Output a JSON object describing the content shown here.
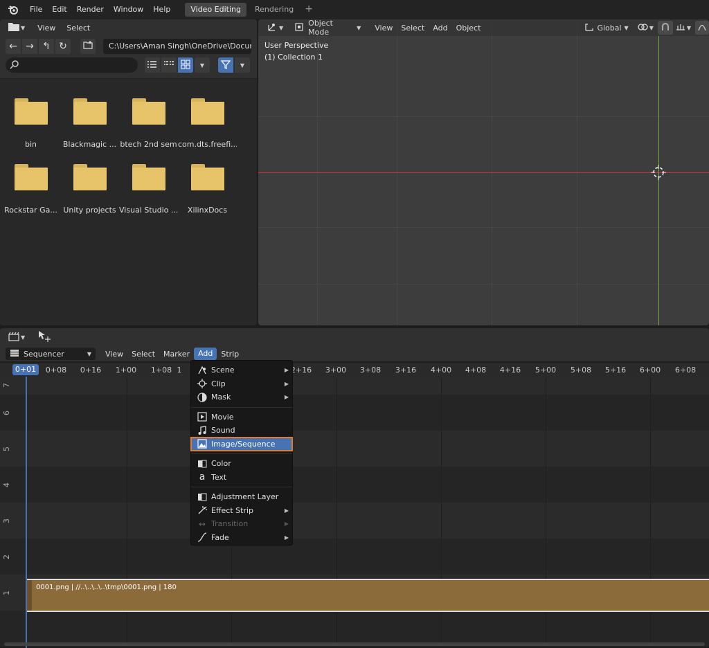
{
  "topbar": {
    "menu": [
      "File",
      "Edit",
      "Render",
      "Window",
      "Help"
    ],
    "workspaces": [
      {
        "label": "Video Editing",
        "active": true
      },
      {
        "label": "Rendering",
        "active": false
      }
    ],
    "add_tab": "+"
  },
  "file_browser": {
    "header": {
      "view": "View",
      "select": "Select"
    },
    "path": "C:\\Users\\Aman Singh\\OneDrive\\Documents\\",
    "search_placeholder": "",
    "folders": [
      "bin",
      "Blackmagic ...",
      "btech 2nd sem",
      "com.dts.freefi...",
      "Rockstar Ga...",
      "Unity projects",
      "Visual Studio ...",
      "XilinxDocs"
    ]
  },
  "viewport": {
    "mode": "Object Mode",
    "menu": [
      "View",
      "Select",
      "Add",
      "Object"
    ],
    "orientation": "Global",
    "perspective_label": "User Perspective",
    "collection_label": "(1) Collection 1"
  },
  "sequencer": {
    "editor_type": "Sequencer",
    "menu": [
      "View",
      "Select",
      "Marker",
      "Add",
      "Strip"
    ],
    "active_menu": "Add",
    "current_frame": "0+01",
    "ruler": [
      "0+08",
      "0+16",
      "1+00",
      "1+08",
      "1",
      "2+16",
      "3+00",
      "3+08",
      "3+16",
      "4+00",
      "4+08",
      "4+16",
      "5+00",
      "5+08",
      "5+16",
      "6+00",
      "6+08"
    ],
    "channels": [
      "7",
      "6",
      "5",
      "4",
      "3",
      "2",
      "1"
    ],
    "strip_label": "0001.png | //..\\..\\..\\..\\tmp\\0001.png | 180"
  },
  "add_menu": {
    "items": [
      {
        "label": "Scene",
        "icon": "scene-icon",
        "submenu": true
      },
      {
        "label": "Clip",
        "icon": "clip-icon",
        "submenu": true
      },
      {
        "label": "Mask",
        "icon": "mask-icon",
        "submenu": true
      },
      {
        "label": "Movie",
        "icon": "movie-icon",
        "submenu": false
      },
      {
        "label": "Sound",
        "icon": "sound-icon",
        "submenu": false
      },
      {
        "label": "Image/Sequence",
        "icon": "image-icon",
        "submenu": false,
        "highlighted": true
      },
      {
        "label": "Color",
        "icon": "color-icon",
        "submenu": false
      },
      {
        "label": "Text",
        "icon": "text-icon",
        "submenu": false
      },
      {
        "label": "Adjustment Layer",
        "icon": "adjustment-icon",
        "submenu": false
      },
      {
        "label": "Effect Strip",
        "icon": "effect-icon",
        "submenu": true
      },
      {
        "label": "Transition",
        "icon": "transition-icon",
        "submenu": true,
        "disabled": true
      },
      {
        "label": "Fade",
        "icon": "fade-icon",
        "submenu": true
      }
    ]
  },
  "colors": {
    "accent": "#4772b3",
    "strip": "#8c6b3b",
    "highlight_box": "#e07b2e",
    "x_axis": "#c0393b",
    "y_axis": "#7aa33a"
  }
}
